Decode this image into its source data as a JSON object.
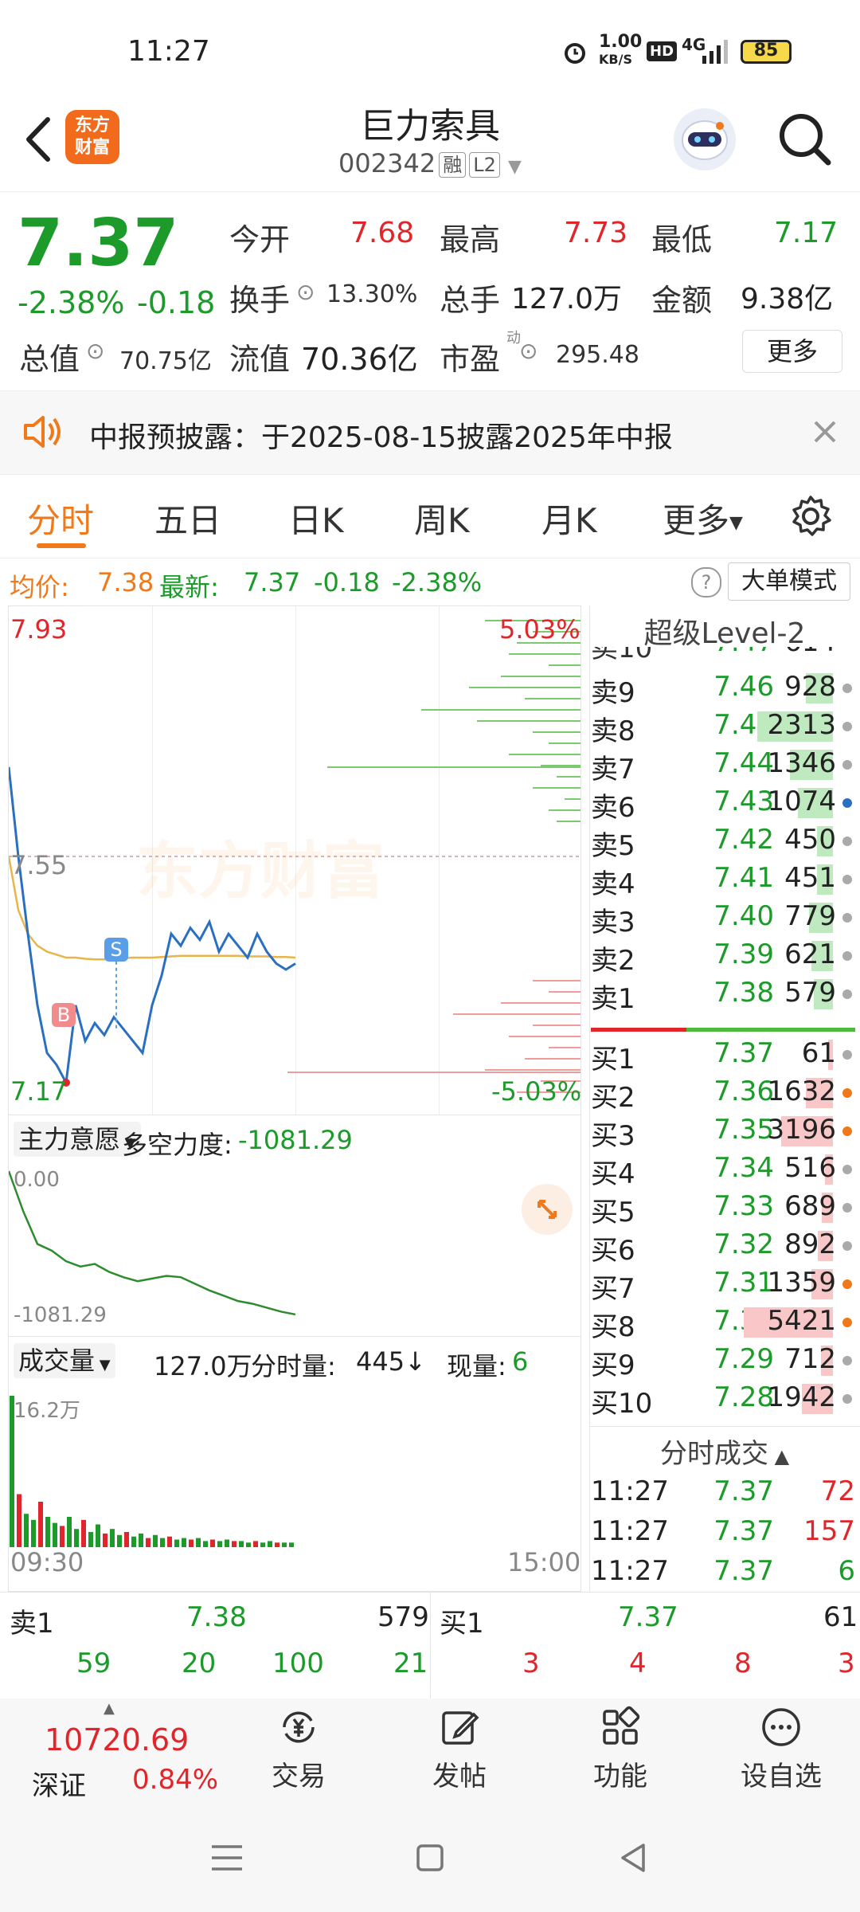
{
  "status": {
    "time": "11:27",
    "net_speed_top": "1.00",
    "net_speed_unit": "KB/S",
    "hd": "HD",
    "network": "4G",
    "battery": "85"
  },
  "header": {
    "logo_line1": "东方",
    "logo_line2": "财富",
    "title": "巨力索具",
    "code": "002342",
    "tag1": "融",
    "tag2": "L2"
  },
  "quote": {
    "price": "7.37",
    "change_pct": "-2.38%",
    "change": "-0.18",
    "open_label": "今开",
    "open": "7.68",
    "high_label": "最高",
    "high": "7.73",
    "low_label": "最低",
    "low": "7.17",
    "turnover_label": "换手",
    "turnover": "13.30%",
    "volume_label": "总手",
    "volume": "127.0万",
    "amount_label": "金额",
    "amount": "9.38亿",
    "mcap_label": "总值",
    "mcap": "70.75亿",
    "float_label": "流值",
    "float": "70.36亿",
    "pe_label": "市盈",
    "pe_sup": "动",
    "pe": "295.48",
    "more": "更多"
  },
  "notice": {
    "text": "中报预披露：于2025-08-15披露2025年中报"
  },
  "tabs": [
    "分时",
    "五日",
    "日K",
    "周K",
    "月K",
    "更多"
  ],
  "info_bar": {
    "avg_label": "均价:",
    "avg": "7.38",
    "latest_label": "最新:",
    "latest": "7.37",
    "chg": "-0.18",
    "pct": "-2.38%",
    "mode_btn": "大单模式"
  },
  "chart": {
    "y_top": "7.93",
    "y_mid": "7.55",
    "y_bot": "7.17",
    "pct_top": "5.03%",
    "pct_bot": "-5.03%",
    "watermark": "东方财富",
    "marker_b": "B",
    "marker_s": "S",
    "price_line": [
      7.7,
      7.55,
      7.42,
      7.3,
      7.22,
      7.2,
      7.17,
      7.3,
      7.24,
      7.27,
      7.25,
      7.28,
      7.26,
      7.24,
      7.22,
      7.3,
      7.35,
      7.42,
      7.4,
      7.43,
      7.41,
      7.44,
      7.39,
      7.42,
      7.4,
      7.38,
      7.42,
      7.39,
      7.37,
      7.36,
      7.37
    ],
    "avg_line": [
      7.55,
      7.46,
      7.42,
      7.4,
      7.39,
      7.385,
      7.38,
      7.38,
      7.378,
      7.377,
      7.377,
      7.378,
      7.379,
      7.38,
      7.38,
      7.38,
      7.381,
      7.382,
      7.383,
      7.383,
      7.383,
      7.383,
      7.383,
      7.383,
      7.383,
      7.382,
      7.382,
      7.382,
      7.381,
      7.381,
      7.38
    ]
  },
  "indicator": {
    "name": "主力意愿",
    "metric_label": "多空力度:",
    "metric": "-1081.29",
    "top": "0.00",
    "bottom": "-1081.29",
    "series": [
      0,
      -300,
      -550,
      -600,
      -680,
      -720,
      -700,
      -760,
      -800,
      -830,
      -810,
      -790,
      -800,
      -850,
      -900,
      -940,
      -980,
      -1000,
      -1030,
      -1060,
      -1081
    ]
  },
  "volume": {
    "name": "成交量",
    "total": "127.0万",
    "tick_label": "分时量:",
    "tick": "445",
    "now_label": "现量:",
    "now": "6",
    "max": "16.2万",
    "t_start": "09:30",
    "t_end": "15:00",
    "bars": [
      1,
      0.35,
      0.22,
      0.18,
      0.3,
      0.2,
      0.16,
      0.14,
      0.2,
      0.12,
      0.18,
      0.1,
      0.15,
      0.09,
      0.12,
      0.08,
      0.1,
      0.07,
      0.09,
      0.06,
      0.08,
      0.06,
      0.07,
      0.05,
      0.06,
      0.05,
      0.06,
      0.04,
      0.05,
      0.04,
      0.05,
      0.04,
      0.04,
      0.03,
      0.04,
      0.03,
      0.04,
      0.03,
      0.03,
      0.03
    ]
  },
  "orderbook": {
    "title": "超级Level-2",
    "asks": [
      {
        "n": "卖9",
        "p": "7.46",
        "q": "928",
        "w": 10
      },
      {
        "n": "卖8",
        "p": "7.45",
        "q": "2313",
        "w": 28
      },
      {
        "n": "卖7",
        "p": "7.44",
        "q": "1346",
        "w": 16
      },
      {
        "n": "卖6",
        "p": "7.43",
        "q": "1074",
        "w": 13
      },
      {
        "n": "卖5",
        "p": "7.42",
        "q": "450",
        "w": 6
      },
      {
        "n": "卖4",
        "p": "7.41",
        "q": "451",
        "w": 6
      },
      {
        "n": "卖3",
        "p": "7.40",
        "q": "779",
        "w": 9
      },
      {
        "n": "卖2",
        "p": "7.39",
        "q": "621",
        "w": 8
      },
      {
        "n": "卖1",
        "p": "7.38",
        "q": "579",
        "w": 7
      }
    ],
    "bids": [
      {
        "n": "买1",
        "p": "7.37",
        "q": "61",
        "w": 1
      },
      {
        "n": "买2",
        "p": "7.36",
        "q": "1632",
        "w": 20
      },
      {
        "n": "买3",
        "p": "7.35",
        "q": "3196",
        "w": 38
      },
      {
        "n": "买4",
        "p": "7.34",
        "q": "516",
        "w": 6
      },
      {
        "n": "买5",
        "p": "7.33",
        "q": "689",
        "w": 8
      },
      {
        "n": "买6",
        "p": "7.32",
        "q": "892",
        "w": 11
      },
      {
        "n": "买7",
        "p": "7.31",
        "q": "1359",
        "w": 16
      },
      {
        "n": "买8",
        "p": "7.30",
        "q": "5421",
        "w": 66
      },
      {
        "n": "买9",
        "p": "7.29",
        "q": "712",
        "w": 9
      },
      {
        "n": "买10",
        "p": "7.28",
        "q": "1942",
        "w": 23
      }
    ],
    "trades_title": "分时成交",
    "trades": [
      {
        "t": "11:27",
        "p": "7.37",
        "q": "72"
      },
      {
        "t": "11:27",
        "p": "7.37",
        "q": "157"
      },
      {
        "t": "11:27",
        "p": "7.37",
        "q": "6"
      }
    ]
  },
  "bottom_quote": {
    "ask_label": "卖1",
    "ask_price": "7.38",
    "ask_qty": "579",
    "bid_label": "买1",
    "bid_price": "7.37",
    "bid_qty": "61",
    "left_nums": [
      "59",
      "20",
      "100",
      "21"
    ],
    "right_nums": [
      "3",
      "4",
      "8",
      "3"
    ]
  },
  "nav": {
    "index_value": "10720.69",
    "index_name": "深证",
    "index_pct": "0.84%",
    "items": [
      "交易",
      "发帖",
      "功能",
      "设自选"
    ]
  },
  "colors": {
    "up": "#e0262b",
    "down": "#1c9a2a",
    "accent": "#f07a1b",
    "price_line": "#2a6fc0",
    "avg_line": "#e8b54a"
  }
}
